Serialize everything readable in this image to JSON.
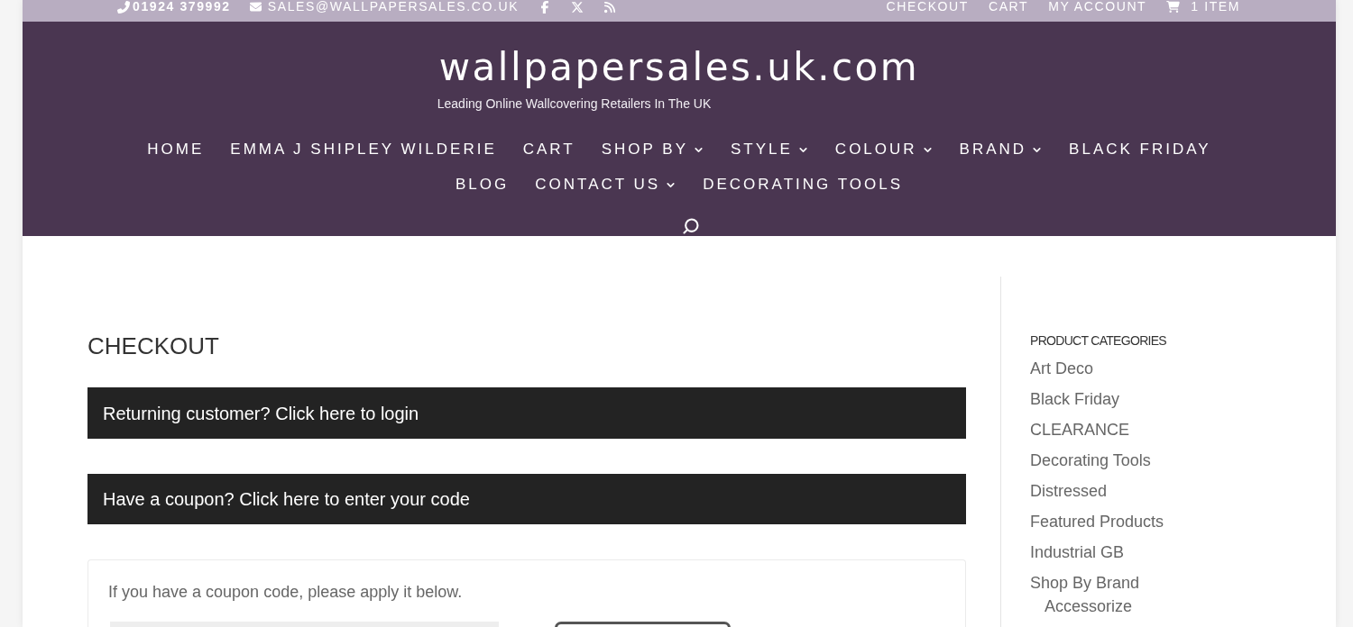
{
  "top_bar": {
    "phone": "01924 379992",
    "email": "SALES@WALLPAPERSALES.CO.UK",
    "social": [
      {
        "kind": "facebook"
      },
      {
        "kind": "x"
      },
      {
        "kind": "rss"
      }
    ],
    "links": [
      "CHECKOUT",
      "CART",
      "MY ACCOUNT"
    ],
    "cart": "1 ITEM"
  },
  "header": {
    "logo": "wallpapersales.uk.com",
    "tagline": "Leading Online Wallcovering Retailers In The UK"
  },
  "nav_rows": [
    [
      {
        "label": "HOME",
        "dropdown": false
      },
      {
        "label": "EMMA J SHIPLEY WILDERIE",
        "dropdown": false
      },
      {
        "label": "CART",
        "dropdown": false
      },
      {
        "label": "SHOP BY",
        "dropdown": true
      },
      {
        "label": "STYLE",
        "dropdown": true
      },
      {
        "label": "COLOUR",
        "dropdown": true
      },
      {
        "label": "BRAND",
        "dropdown": true
      },
      {
        "label": "BLACK FRIDAY",
        "dropdown": false
      }
    ],
    [
      {
        "label": "BLOG",
        "dropdown": false
      },
      {
        "label": "CONTACT US",
        "dropdown": true
      },
      {
        "label": "DECORATING TOOLS",
        "dropdown": false
      }
    ]
  ],
  "page_title": "CHECKOUT",
  "notices": [
    "Returning customer? Click here to login",
    "Have a coupon? Click here to enter your code"
  ],
  "coupon_form": {
    "message": "If you have a coupon code, please apply it below."
  },
  "sidebar": {
    "heading": "PRODUCT CATEGORIES",
    "categories": [
      {
        "label": "Art Deco"
      },
      {
        "label": "Black Friday"
      },
      {
        "label": "CLEARANCE"
      },
      {
        "label": "Decorating Tools"
      },
      {
        "label": "Distressed"
      },
      {
        "label": "Featured Products"
      },
      {
        "label": "Industrial GB"
      },
      {
        "label": "Shop By Brand",
        "children": [
          {
            "label": "Accessorize"
          }
        ]
      }
    ]
  }
}
